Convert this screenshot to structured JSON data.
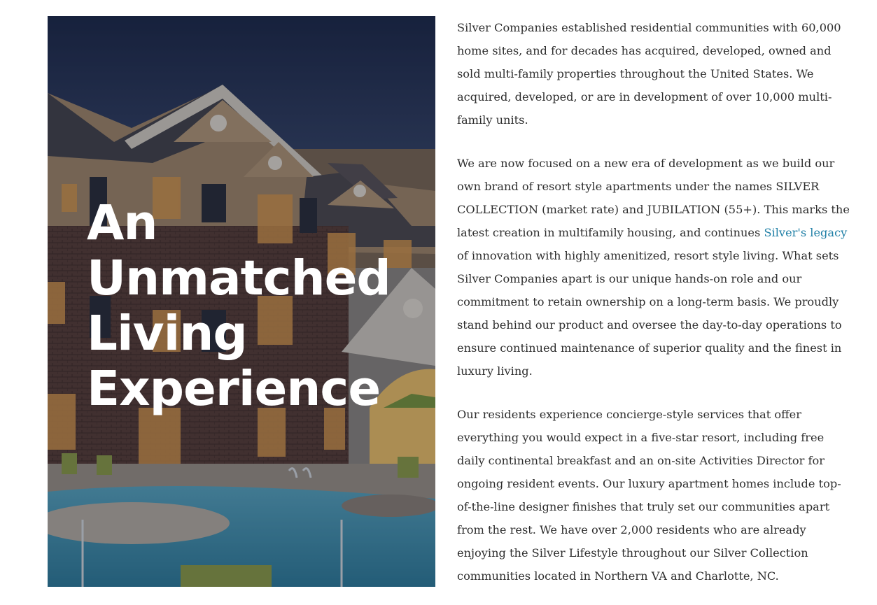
{
  "hero": {
    "title_lines": [
      "An",
      "Unmatched",
      "Living",
      "Experience"
    ]
  },
  "content": {
    "paragraph1": {
      "lines": [
        "Silver Companies established residential communities with 60,000",
        "home sites, and for decades has acquired, developed, owned and",
        "sold multi-family properties throughout the United States. We",
        "acquired, developed, or are in development of over 10,000 multi-",
        "family units."
      ]
    },
    "paragraph2": {
      "lines": [
        "We are now focused on a new era of development as we build our",
        "own brand of resort style apartments under the names SILVER",
        "COLLECTION (market rate) and JUBILATION (55+). This marks the"
      ],
      "line4_prefix": "latest creation in multifamily housing, and continues ",
      "link_text": "Silver's legacy",
      "lines_after": [
        "of innovation with highly amenitized, resort style living. What sets",
        "Silver Companies apart is our unique hands-on role and our",
        "commitment to retain ownership on a long-term basis. We proudly",
        "stand behind our product and oversee the day-to-day operations to",
        "ensure continued maintenance of superior quality and the finest in",
        "luxury living."
      ]
    },
    "paragraph3": {
      "lines": [
        "Our residents experience concierge-style services that offer",
        "everything you would expect in a five-star resort, including free",
        "daily continental breakfast and an on-site Activities Director for",
        "ongoing resident events. Our luxury apartment homes include top-",
        "of-the-line designer finishes that truly set our communities apart",
        "from the rest. We have over 2,000 residents who are already",
        "enjoying the Silver Lifestyle throughout our Silver Collection",
        "communities located in Northern VA and Charlotte, NC."
      ]
    }
  },
  "colors": {
    "link": "#1f7fa6",
    "body_text": "#2e2e2e",
    "hero_text": "#ffffff"
  }
}
